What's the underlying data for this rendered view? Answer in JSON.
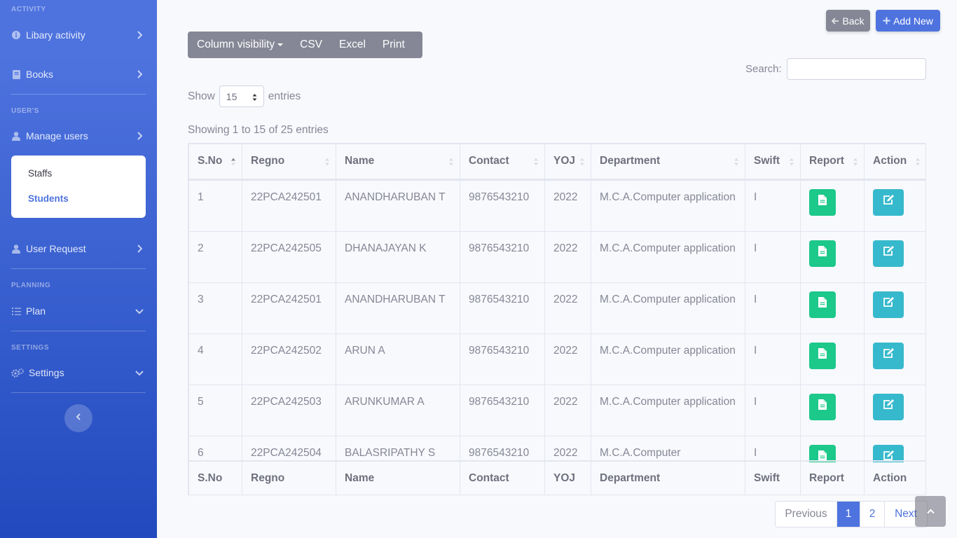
{
  "sidebar": {
    "headings": {
      "activity": "ACTIVITY",
      "users": "USER'S",
      "planning": "PLANNING",
      "settings": "SETTINGS"
    },
    "items": {
      "library_activity": "Libary activity",
      "books": "Books",
      "manage_users": "Manage users",
      "user_request": "User Request",
      "plan": "Plan",
      "settings": "Settings"
    },
    "submenu": {
      "staffs": "Staffs",
      "students": "Students"
    }
  },
  "header_buttons": {
    "back": "Back",
    "add_new": "Add New"
  },
  "toolbar": {
    "column_visibility": "Column visibility",
    "csv": "CSV",
    "excel": "Excel",
    "print": "Print"
  },
  "search": {
    "label": "Search:",
    "value": ""
  },
  "length": {
    "show": "Show",
    "value": "15",
    "entries": "entries"
  },
  "info": "Showing 1 to 15 of 25 entries",
  "table": {
    "columns": [
      "S.No",
      "Regno",
      "Name",
      "Contact",
      "YOJ",
      "Department",
      "Swift",
      "Report",
      "Action"
    ],
    "rows": [
      {
        "sno": "1",
        "regno": "22PCA242501",
        "name": "ANANDHARUBAN T",
        "contact": "9876543210",
        "yoj": "2022",
        "department": "M.C.A.Computer application",
        "swift": "I"
      },
      {
        "sno": "2",
        "regno": "22PCA242505",
        "name": "DHANAJAYAN K",
        "contact": "9876543210",
        "yoj": "2022",
        "department": "M.C.A.Computer application",
        "swift": "I"
      },
      {
        "sno": "3",
        "regno": "22PCA242501",
        "name": "ANANDHARUBAN T",
        "contact": "9876543210",
        "yoj": "2022",
        "department": "M.C.A.Computer application",
        "swift": "I"
      },
      {
        "sno": "4",
        "regno": "22PCA242502",
        "name": "ARUN A",
        "contact": "9876543210",
        "yoj": "2022",
        "department": "M.C.A.Computer application",
        "swift": "I"
      },
      {
        "sno": "5",
        "regno": "22PCA242503",
        "name": "ARUNKUMAR A",
        "contact": "9876543210",
        "yoj": "2022",
        "department": "M.C.A.Computer application",
        "swift": "I"
      },
      {
        "sno": "6",
        "regno": "22PCA242504",
        "name": "BALASRIPATHY S",
        "contact": "9876543210",
        "yoj": "2022",
        "department": "M.C.A.Computer",
        "swift": "I"
      }
    ]
  },
  "pagination": {
    "previous": "Previous",
    "page1": "1",
    "page2": "2",
    "next": "Next"
  },
  "colors": {
    "primary": "#4e73df",
    "secondary": "#858796",
    "success": "#1cc88a",
    "info": "#36b9cc"
  }
}
